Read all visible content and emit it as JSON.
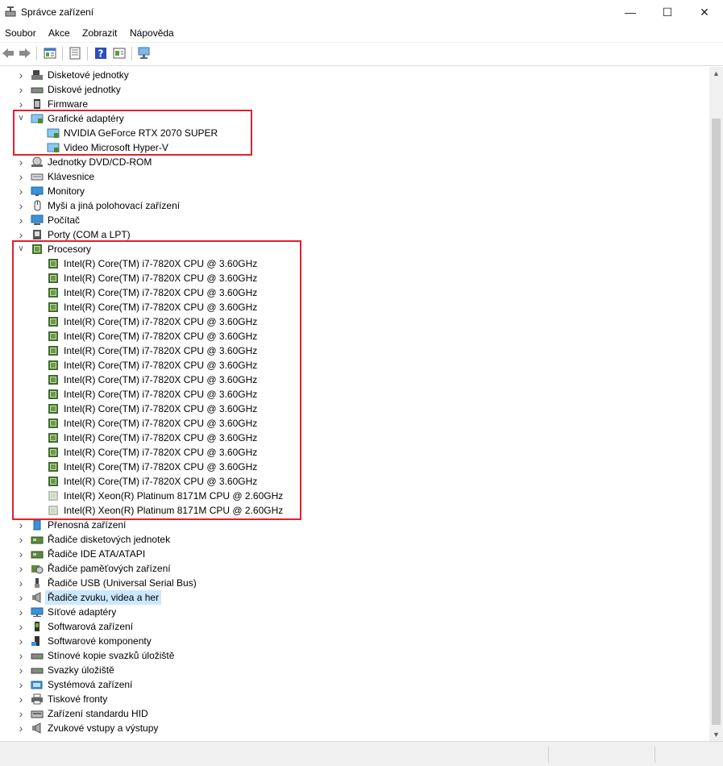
{
  "window": {
    "title": "Správce zařízení",
    "minimize_glyph": "—",
    "maximize_glyph": "☐",
    "close_glyph": "✕"
  },
  "menu": [
    "Soubor",
    "Akce",
    "Zobrazit",
    "Nápověda"
  ],
  "toolbar": [
    "back-icon",
    "forward-icon",
    "properties-icon",
    "list-view-icon",
    "help-icon",
    "update-driver-icon",
    "monitor-scan-icon"
  ],
  "tree": [
    {
      "label": "Disketové jednotky",
      "icon": "floppy-drive-icon",
      "level": 0,
      "expanded": false
    },
    {
      "label": "Diskové jednotky",
      "icon": "disk-drive-icon",
      "level": 0,
      "expanded": false
    },
    {
      "label": "Firmware",
      "icon": "firmware-icon",
      "level": 0,
      "expanded": false
    },
    {
      "label": "Grafické adaptéry",
      "icon": "display-adapter-icon",
      "level": 0,
      "expanded": true
    },
    {
      "label": "NVIDIA GeForce RTX 2070 SUPER",
      "icon": "display-adapter-icon",
      "level": 1
    },
    {
      "label": "Video Microsoft Hyper-V",
      "icon": "display-adapter-icon",
      "level": 1
    },
    {
      "label": "Jednotky DVD/CD-ROM",
      "icon": "dvd-drive-icon",
      "level": 0,
      "expanded": false
    },
    {
      "label": "Klávesnice",
      "icon": "keyboard-icon",
      "level": 0,
      "expanded": false
    },
    {
      "label": "Monitory",
      "icon": "monitor-icon",
      "level": 0,
      "expanded": false
    },
    {
      "label": "Myši a jiná polohovací zařízení",
      "icon": "mouse-icon",
      "level": 0,
      "expanded": false
    },
    {
      "label": "Počítač",
      "icon": "computer-icon",
      "level": 0,
      "expanded": false
    },
    {
      "label": "Porty (COM a LPT)",
      "icon": "port-icon",
      "level": 0,
      "expanded": false
    },
    {
      "label": "Procesory",
      "icon": "processor-icon",
      "level": 0,
      "expanded": true
    },
    {
      "label": "Intel(R) Core(TM) i7-7820X CPU @ 3.60GHz",
      "icon": "processor-icon",
      "level": 1
    },
    {
      "label": "Intel(R) Core(TM) i7-7820X CPU @ 3.60GHz",
      "icon": "processor-icon",
      "level": 1
    },
    {
      "label": "Intel(R) Core(TM) i7-7820X CPU @ 3.60GHz",
      "icon": "processor-icon",
      "level": 1
    },
    {
      "label": "Intel(R) Core(TM) i7-7820X CPU @ 3.60GHz",
      "icon": "processor-icon",
      "level": 1
    },
    {
      "label": "Intel(R) Core(TM) i7-7820X CPU @ 3.60GHz",
      "icon": "processor-icon",
      "level": 1
    },
    {
      "label": "Intel(R) Core(TM) i7-7820X CPU @ 3.60GHz",
      "icon": "processor-icon",
      "level": 1
    },
    {
      "label": "Intel(R) Core(TM) i7-7820X CPU @ 3.60GHz",
      "icon": "processor-icon",
      "level": 1
    },
    {
      "label": "Intel(R) Core(TM) i7-7820X CPU @ 3.60GHz",
      "icon": "processor-icon",
      "level": 1
    },
    {
      "label": "Intel(R) Core(TM) i7-7820X CPU @ 3.60GHz",
      "icon": "processor-icon",
      "level": 1
    },
    {
      "label": "Intel(R) Core(TM) i7-7820X CPU @ 3.60GHz",
      "icon": "processor-icon",
      "level": 1
    },
    {
      "label": "Intel(R) Core(TM) i7-7820X CPU @ 3.60GHz",
      "icon": "processor-icon",
      "level": 1
    },
    {
      "label": "Intel(R) Core(TM) i7-7820X CPU @ 3.60GHz",
      "icon": "processor-icon",
      "level": 1
    },
    {
      "label": "Intel(R) Core(TM) i7-7820X CPU @ 3.60GHz",
      "icon": "processor-icon",
      "level": 1
    },
    {
      "label": "Intel(R) Core(TM) i7-7820X CPU @ 3.60GHz",
      "icon": "processor-icon",
      "level": 1
    },
    {
      "label": "Intel(R) Core(TM) i7-7820X CPU @ 3.60GHz",
      "icon": "processor-icon",
      "level": 1
    },
    {
      "label": "Intel(R) Core(TM) i7-7820X CPU @ 3.60GHz",
      "icon": "processor-icon",
      "level": 1
    },
    {
      "label": "Intel(R) Xeon(R) Platinum 8171M CPU @ 2.60GHz",
      "icon": "processor-icon",
      "level": 1,
      "dim": true
    },
    {
      "label": "Intel(R) Xeon(R) Platinum 8171M CPU @ 2.60GHz",
      "icon": "processor-icon",
      "level": 1,
      "dim": true
    },
    {
      "label": "Přenosná zařízení",
      "icon": "portable-device-icon",
      "level": 0,
      "expanded": false
    },
    {
      "label": "Řadiče disketových jednotek",
      "icon": "controller-icon",
      "level": 0,
      "expanded": false
    },
    {
      "label": "Řadiče IDE ATA/ATAPI",
      "icon": "controller-icon",
      "level": 0,
      "expanded": false
    },
    {
      "label": "Řadiče paměťových zařízení",
      "icon": "storage-controller-icon",
      "level": 0,
      "expanded": false
    },
    {
      "label": "Řadiče USB (Universal Serial Bus)",
      "icon": "usb-icon",
      "level": 0,
      "expanded": false
    },
    {
      "label": "Řadiče zvuku, videa a her",
      "icon": "speaker-icon",
      "level": 0,
      "expanded": false,
      "selected": true
    },
    {
      "label": "Síťové adaptéry",
      "icon": "network-adapter-icon",
      "level": 0,
      "expanded": false
    },
    {
      "label": "Softwarová zařízení",
      "icon": "software-device-icon",
      "level": 0,
      "expanded": false
    },
    {
      "label": "Softwarové komponenty",
      "icon": "software-component-icon",
      "level": 0,
      "expanded": false
    },
    {
      "label": "Stínové kopie svazků úložiště",
      "icon": "disk-drive-icon",
      "level": 0,
      "expanded": false
    },
    {
      "label": "Svazky úložiště",
      "icon": "disk-drive-icon",
      "level": 0,
      "expanded": false
    },
    {
      "label": "Systémová zařízení",
      "icon": "system-device-icon",
      "level": 0,
      "expanded": false
    },
    {
      "label": "Tiskové fronty",
      "icon": "printer-icon",
      "level": 0,
      "expanded": false
    },
    {
      "label": "Zařízení standardu HID",
      "icon": "hid-icon",
      "level": 0,
      "expanded": false
    },
    {
      "label": "Zvukové vstupy a výstupy",
      "icon": "speaker-icon",
      "level": 0,
      "expanded": false
    }
  ],
  "colors": {
    "highlight_box": "#e3202d",
    "selection": "#cce8ff"
  }
}
